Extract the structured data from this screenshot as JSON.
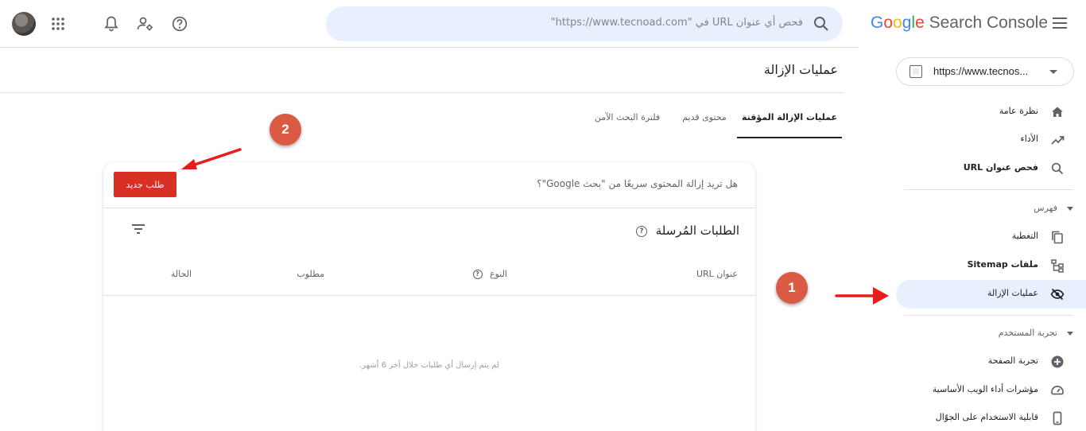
{
  "header": {
    "brand_letters": [
      "G",
      "o",
      "o",
      "g",
      "l",
      "e"
    ],
    "brand_product": "Search Console",
    "search_placeholder": "فحص أي عنوان URL في \"https://www.tecnoad.com\"",
    "icons": [
      "apps-icon",
      "bell-icon",
      "manage-users-icon",
      "help-icon",
      "search-icon",
      "menu-icon"
    ]
  },
  "sidebar": {
    "property_url": "https://www.tecnos...",
    "items": [
      {
        "label": "نظرة عامة",
        "icon": "home-icon"
      },
      {
        "label": "الأداء",
        "icon": "trending-icon"
      },
      {
        "label": "فحص عنوان URL",
        "icon": "search-icon"
      }
    ],
    "section_index": {
      "label": "فهرس"
    },
    "index_items": [
      {
        "label": "التغطية",
        "icon": "copy-icon"
      },
      {
        "label": "ملفات Sitemap",
        "icon": "sitemap-icon"
      },
      {
        "label": "عمليات الإزالة",
        "icon": "eye-off-icon"
      }
    ],
    "section_experience": {
      "label": "تجربة المستخدم"
    },
    "experience_items": [
      {
        "label": "تجربة الصفحة",
        "icon": "plus-circle-icon"
      },
      {
        "label": "مؤشرات أداء الويب الأساسية",
        "icon": "speed-icon"
      },
      {
        "label": "قابلية الاستخدام على الجوّال",
        "icon": "phone-icon"
      }
    ]
  },
  "main": {
    "title": "عمليات الإزالة",
    "tabs": [
      {
        "label": "عمليات الإزالة المؤقتة"
      },
      {
        "label": "محتوى قديم"
      },
      {
        "label": "فلترة البحث الآمن"
      }
    ],
    "prompt": "هل تريد إزالة المحتوى سريعًا من \"بحث Google\"؟",
    "new_request_label": "طلب جديد",
    "submitted_title": "الطلبات المُرسلة",
    "columns": {
      "url": "عنوان URL",
      "type": "النوع",
      "requested": "مطلوب",
      "status": "الحالة"
    },
    "empty_message": "لم يتم إرسال أي طلبات خلال آخر 6 أشهر."
  },
  "annotations": {
    "badge1": "1",
    "badge2": "2",
    "color": "#db5a44",
    "arrow_color": "#e81c1c"
  }
}
